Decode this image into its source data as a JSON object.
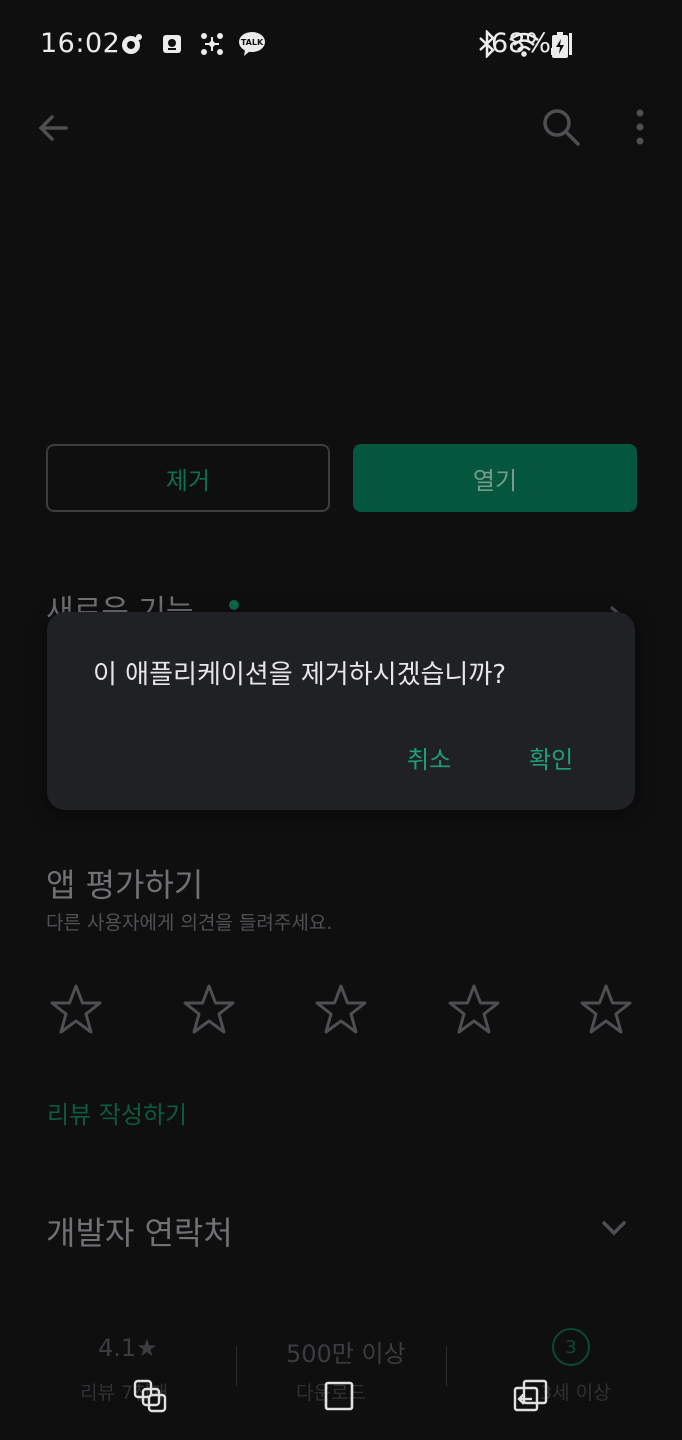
{
  "status_bar": {
    "time": "16:02",
    "battery": "68%",
    "notification_icons": [
      "camera-notif-icon",
      "screenshot-icon",
      "connect-icon",
      "kakaotalk-icon"
    ],
    "kakaotalk_label": "TALK"
  },
  "app_bar": {
    "back_icon": "arrow-left-icon",
    "search_icon": "search-icon",
    "more_icon": "more-vert-icon"
  },
  "actions": {
    "uninstall_label": "제거",
    "open_label": "열기"
  },
  "whats_new": {
    "title": "새로운 기능"
  },
  "dialog": {
    "message": "이 애플리케이션을 제거하시겠습니까?",
    "cancel_label": "취소",
    "confirm_label": "확인"
  },
  "rate": {
    "title": "앱 평가하기",
    "subtitle": "다른 사용자에게 의견을 들려주세요.",
    "star_count": 5,
    "write_review_label": "리뷰 작성하기"
  },
  "developer": {
    "title": "개발자 연락처"
  },
  "stats": {
    "rating_value": "4.1★",
    "rating_label": "리뷰 7천개",
    "downloads_value": "500만 이상",
    "downloads_label": "다운로드",
    "age_badge": "3",
    "age_label": "3세 이상"
  },
  "colors": {
    "background": "#0f0f10",
    "dialog": "#202124",
    "accent": "#1e9e76",
    "open_button": "#04573d"
  }
}
